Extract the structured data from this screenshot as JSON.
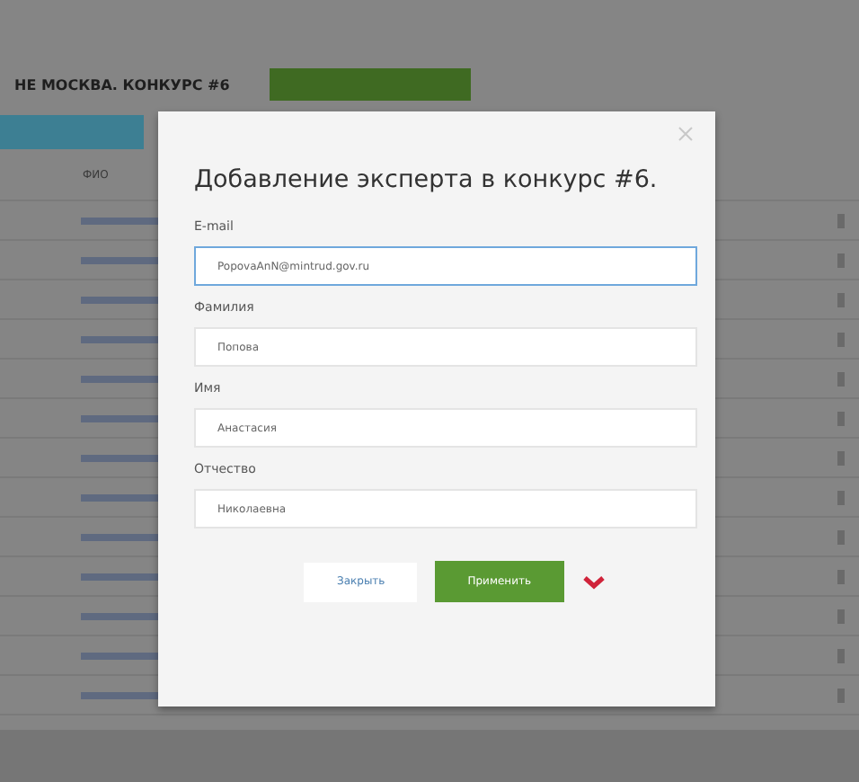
{
  "page": {
    "title": "НЕ МОСКВА. КОНКУРС #6",
    "table": {
      "columns": [
        "ФИО"
      ]
    }
  },
  "dialog": {
    "title": "Добавление эксперта в конкурс #6.",
    "fields": [
      {
        "label": "E-mail",
        "value": "PopovaAnN@mintrud.gov.ru",
        "focused": true
      },
      {
        "label": "Фамилия",
        "value": "Попова",
        "focused": false
      },
      {
        "label": "Имя",
        "value": "Анастасия",
        "focused": false
      },
      {
        "label": "Отчество",
        "value": "Николаевна",
        "focused": false
      }
    ],
    "buttons": [
      {
        "label": "Закрыть",
        "kind": "secondary"
      },
      {
        "label": "Применить",
        "kind": "primary"
      }
    ]
  }
}
